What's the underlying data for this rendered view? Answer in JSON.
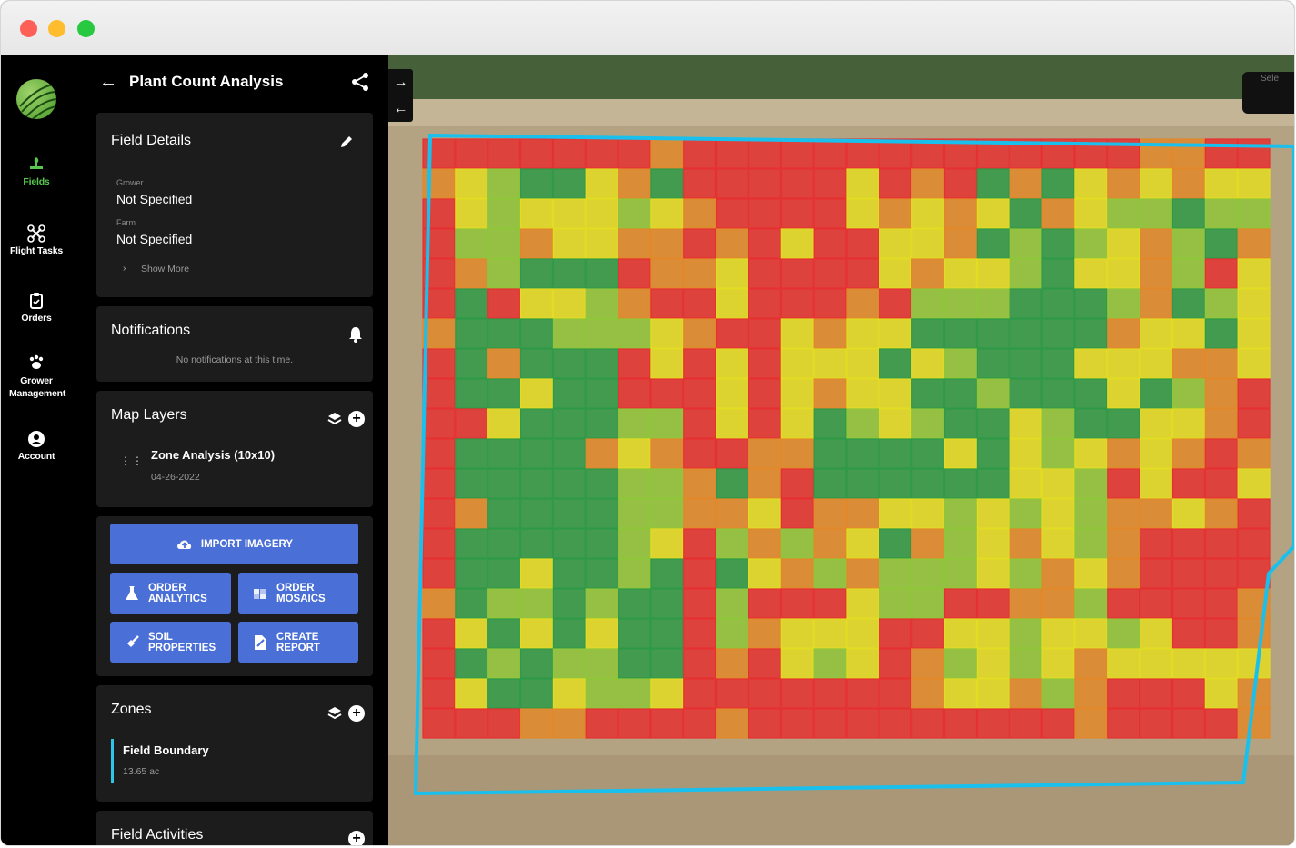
{
  "window": {
    "controls": [
      "close",
      "minimize",
      "maximize"
    ]
  },
  "rail": {
    "logo": "globe-leaf-logo",
    "items": [
      {
        "label": "Fields",
        "icon": "fields-icon",
        "active": true
      },
      {
        "label": "Flight Tasks",
        "icon": "drone-icon",
        "active": false
      },
      {
        "label": "Orders",
        "icon": "clipboard-icon",
        "active": false
      },
      {
        "label": "Grower Management",
        "icon": "paw-icon",
        "active": false
      },
      {
        "label": "Account",
        "icon": "account-icon",
        "active": false
      }
    ],
    "active_color": "#57c84d"
  },
  "panel": {
    "title": "Plant Count Analysis",
    "field_details": {
      "title": "Field Details",
      "grower_label": "Grower",
      "grower_value": "Not Specified",
      "farm_label": "Farm",
      "farm_value": "Not Specified",
      "show_more": "Show More"
    },
    "notifications": {
      "title": "Notifications",
      "empty": "No notifications at this time."
    },
    "map_layers": {
      "title": "Map Layers",
      "layer_name": "Zone Analysis (10x10)",
      "layer_date": "04-26-2022"
    },
    "actions": {
      "import": "IMPORT IMAGERY",
      "order_analytics_1": "ORDER",
      "order_analytics_2": "ANALYTICS",
      "order_mosaics_1": "ORDER",
      "order_mosaics_2": "MOSAICS",
      "soil_1": "SOIL",
      "soil_2": "PROPERTIES",
      "report_1": "CREATE",
      "report_2": "REPORT",
      "button_color": "#4a6fd6"
    },
    "zones": {
      "title": "Zones",
      "boundary_name": "Field Boundary",
      "boundary_area": "13.65 ac",
      "accent": "#2ec5e8"
    },
    "activities": {
      "title": "Field Activities"
    }
  },
  "map": {
    "select_label": "Sele",
    "legend_colors": [
      "#e53131",
      "#e2882a",
      "#e3dc23",
      "#8fc63a",
      "#2f9a48"
    ],
    "boundary_color": "#19c0ee"
  }
}
